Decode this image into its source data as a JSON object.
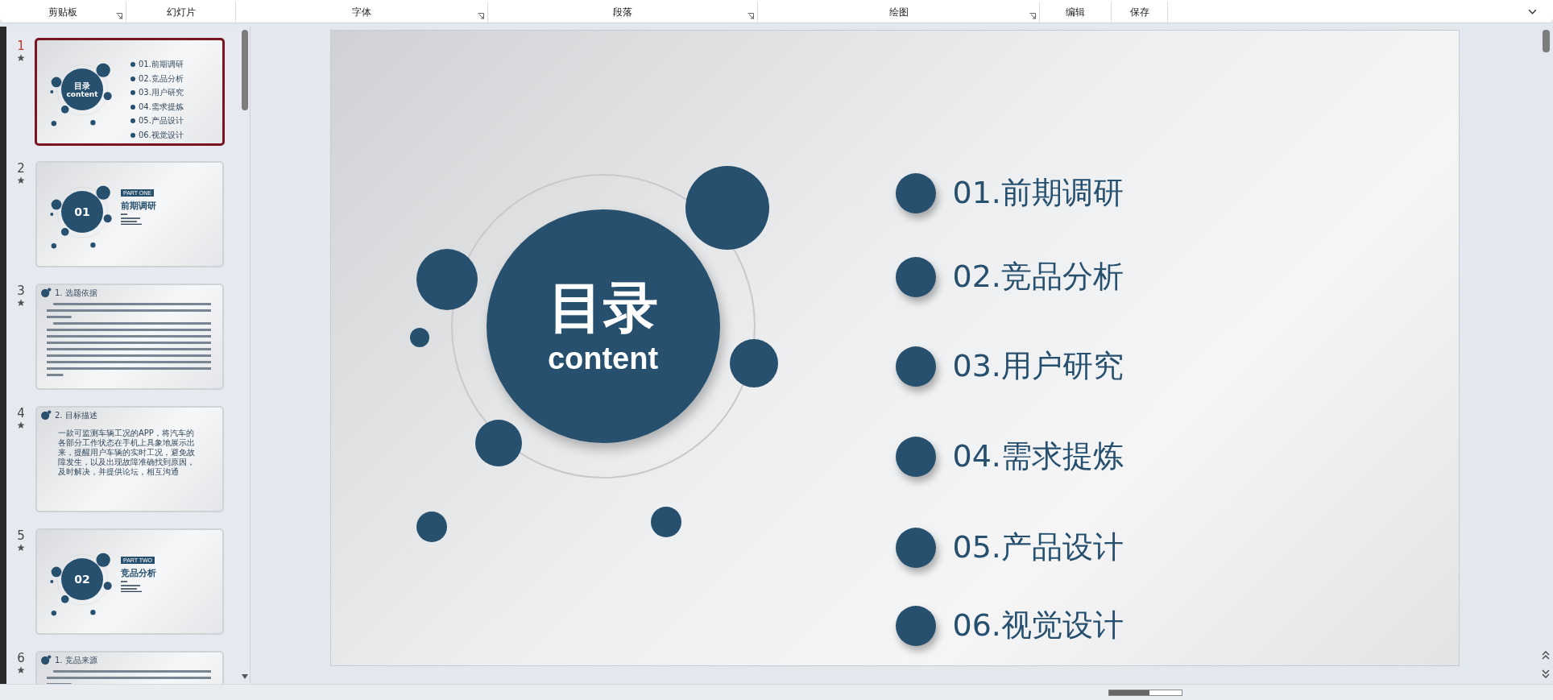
{
  "ribbon": {
    "groups": [
      {
        "label": "剪贴板",
        "launcher": true
      },
      {
        "label": "幻灯片",
        "launcher": false
      },
      {
        "label": "字体",
        "launcher": true
      },
      {
        "label": "段落",
        "launcher": true
      },
      {
        "label": "绘图",
        "launcher": true
      },
      {
        "label": "编辑",
        "launcher": false
      },
      {
        "label": "保存",
        "launcher": false
      }
    ]
  },
  "thumbnails": [
    {
      "number": "1",
      "selected": true,
      "kind": "contents",
      "heading": "目录",
      "subheading": "content",
      "items": [
        "01.前期调研",
        "02.竞品分析",
        "03.用户研究",
        "04.需求提炼",
        "05.产品设计",
        "06.视觉设计"
      ]
    },
    {
      "number": "2",
      "selected": false,
      "kind": "section",
      "badge": "PART ONE",
      "number_text": "01",
      "title": "前期调研"
    },
    {
      "number": "3",
      "selected": false,
      "kind": "text",
      "title": "1. 选题依据"
    },
    {
      "number": "4",
      "selected": false,
      "kind": "text",
      "title": "2. 目标描述",
      "body": "一款可监测车辆工况的APP，将汽车的各部分工作状态在手机上具象地展示出来，提醒用户车辆的实时工况，避免故障发生，以及出现故障准确找到原因，及时解决，并提供论坛，相互沟通"
    },
    {
      "number": "5",
      "selected": false,
      "kind": "section",
      "badge": "PART TWO",
      "number_text": "02",
      "title": "竞品分析"
    },
    {
      "number": "6",
      "selected": false,
      "kind": "text",
      "title": "1. 竞品来源"
    }
  ],
  "status_bar": {
    "zoom": {
      "level": 0.55
    }
  },
  "slide": {
    "heading": "目录",
    "subheading": "content",
    "items": [
      "01.前期调研",
      "02.竞品分析",
      "03.用户研究",
      "04.需求提炼",
      "05.产品设计",
      "06.视觉设计"
    ]
  }
}
